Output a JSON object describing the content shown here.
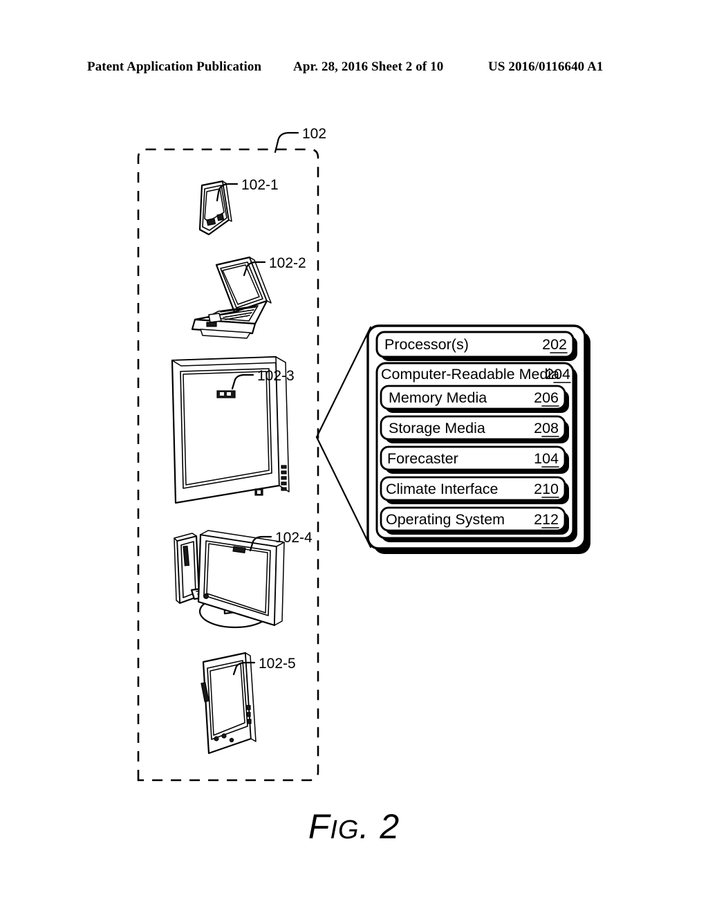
{
  "header": {
    "left": "Patent Application Publication",
    "middle": "Apr. 28, 2016  Sheet 2 of 10",
    "right": "US 2016/0116640 A1"
  },
  "figure": {
    "caption_main": "F",
    "caption_rest": "IG",
    "caption_tail": ". 2",
    "caption_full": "FIG. 2",
    "group_ref": "102"
  },
  "devices": [
    {
      "ref": "102-1",
      "icon": "smartphone-icon"
    },
    {
      "ref": "102-2",
      "icon": "laptop-icon"
    },
    {
      "ref": "102-3",
      "icon": "flat-panel-display-icon"
    },
    {
      "ref": "102-4",
      "icon": "desktop-computer-icon"
    },
    {
      "ref": "102-5",
      "icon": "tablet-icon"
    }
  ],
  "component_box": {
    "processor": {
      "label": "Processor(s)",
      "ref": "202"
    },
    "media": {
      "label": "Computer-Readable Media",
      "ref": "204"
    },
    "media_items": [
      {
        "label": "Memory Media",
        "ref": "206"
      },
      {
        "label": "Storage Media",
        "ref": "208"
      },
      {
        "label": "Forecaster",
        "ref": "104"
      },
      {
        "label": "Climate Interface",
        "ref": "210"
      },
      {
        "label": "Operating System",
        "ref": "212"
      }
    ]
  },
  "colors": {
    "ink": "#000000",
    "paper": "#ffffff"
  }
}
